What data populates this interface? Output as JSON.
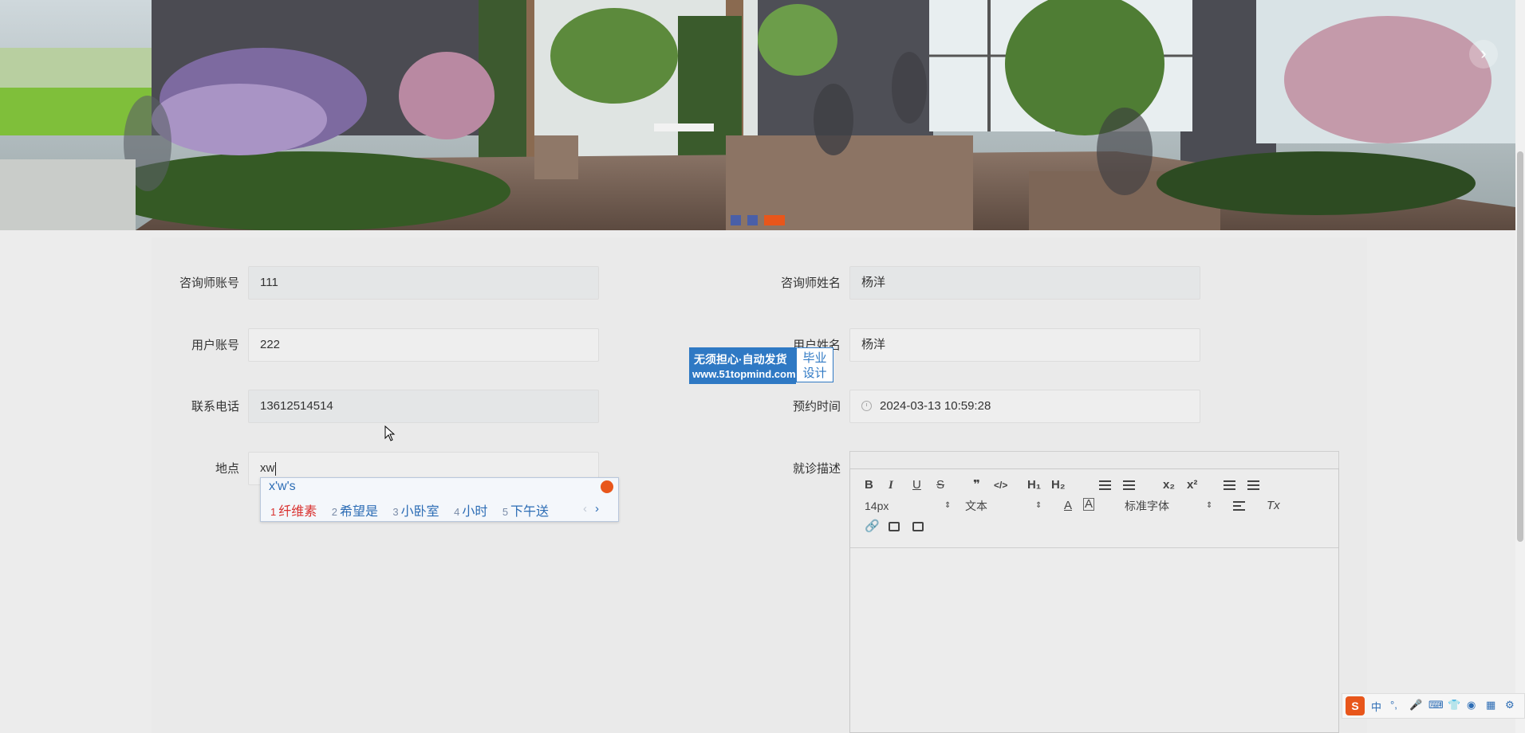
{
  "banner": {
    "slides": 3,
    "active_slide": 3,
    "next_arrow": "›"
  },
  "form": {
    "consultant_account": {
      "label": "咨询师账号",
      "value": "111"
    },
    "consultant_name": {
      "label": "咨询师姓名",
      "value": "杨洋"
    },
    "user_account": {
      "label": "用户账号",
      "value": "222"
    },
    "user_name": {
      "label": "用户姓名",
      "value": "杨洋"
    },
    "phone": {
      "label": "联系电话",
      "value": "13612514514"
    },
    "appointment_time": {
      "label": "预约时间",
      "value": "2024-03-13 10:59:28"
    },
    "location": {
      "label": "地点",
      "value": "xw"
    },
    "description": {
      "label": "就诊描述"
    }
  },
  "ime": {
    "composition": "x'w's",
    "candidates": [
      {
        "n": "1",
        "text": "纤维素"
      },
      {
        "n": "2",
        "text": "希望是"
      },
      {
        "n": "3",
        "text": "小卧室"
      },
      {
        "n": "4",
        "text": "小时"
      },
      {
        "n": "5",
        "text": "下午送"
      }
    ],
    "prev": "‹",
    "next": "›"
  },
  "watermark": {
    "line1": "无须担心·自动发货",
    "line2": "www.51topmind.com",
    "badge_line1": "毕业",
    "badge_line2": "设计"
  },
  "editor": {
    "toolbar": {
      "bold": "B",
      "italic": "I",
      "underline": "U",
      "strike": "S",
      "quote": "❞",
      "code": "</>",
      "h1": "H₁",
      "h2": "H₂",
      "ordered_list": "⒈",
      "subscript": "x₂",
      "superscript": "x²",
      "font_size": "14px",
      "paragraph": "文本",
      "font_color": "A",
      "bg_color": "A",
      "font_family": "标准字体",
      "clear_format": "Tx"
    }
  },
  "tray": {
    "s": "S",
    "lang": "中",
    "punct": "°,"
  }
}
